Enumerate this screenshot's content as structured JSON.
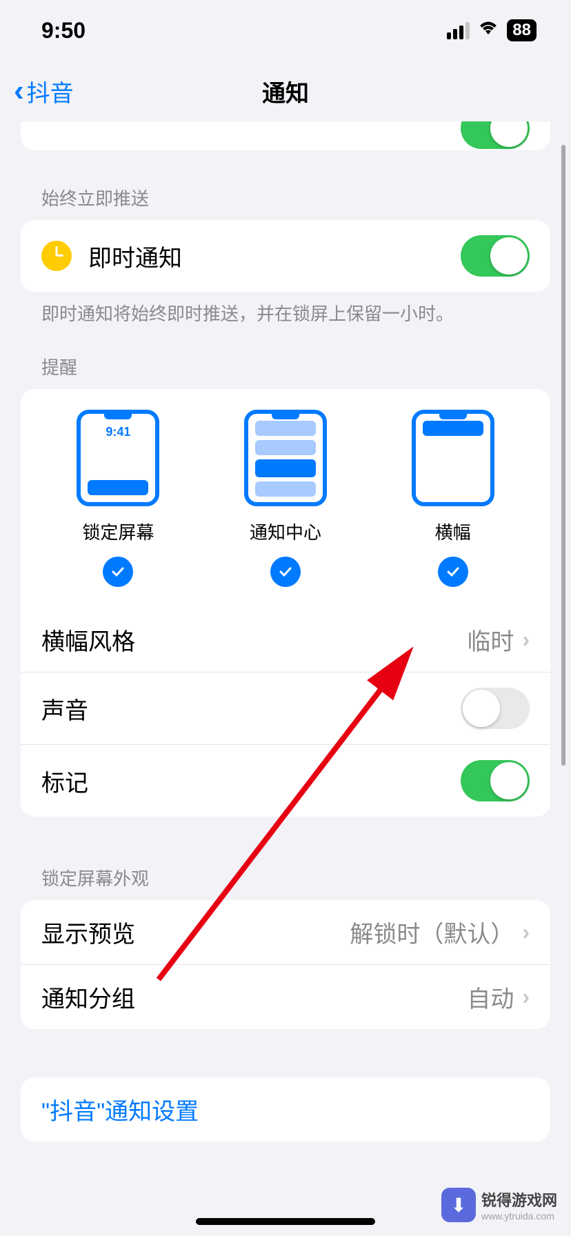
{
  "status_bar": {
    "time": "9:50",
    "battery": "88"
  },
  "nav": {
    "back_label": "抖音",
    "title": "通知"
  },
  "sections": {
    "always_deliver": {
      "header": "始终立即推送",
      "instant_label": "即时通知",
      "footer": "即时通知将始终即时推送，并在锁屏上保留一小时。"
    },
    "alerts": {
      "header": "提醒",
      "options": [
        {
          "label": "锁定屏幕",
          "mock_time": "9:41"
        },
        {
          "label": "通知中心"
        },
        {
          "label": "横幅"
        }
      ],
      "banner_style": {
        "label": "横幅风格",
        "value": "临时"
      },
      "sounds": {
        "label": "声音"
      },
      "badges": {
        "label": "标记"
      }
    },
    "lock_screen_appearance": {
      "header": "锁定屏幕外观",
      "show_previews": {
        "label": "显示预览",
        "value": "解锁时（默认）"
      },
      "grouping": {
        "label": "通知分组",
        "value": "自动"
      }
    },
    "app_settings": {
      "label": "\"抖音\"通知设置"
    }
  },
  "watermark": {
    "title": "锐得游戏网",
    "url": "www.ytruida.com"
  }
}
